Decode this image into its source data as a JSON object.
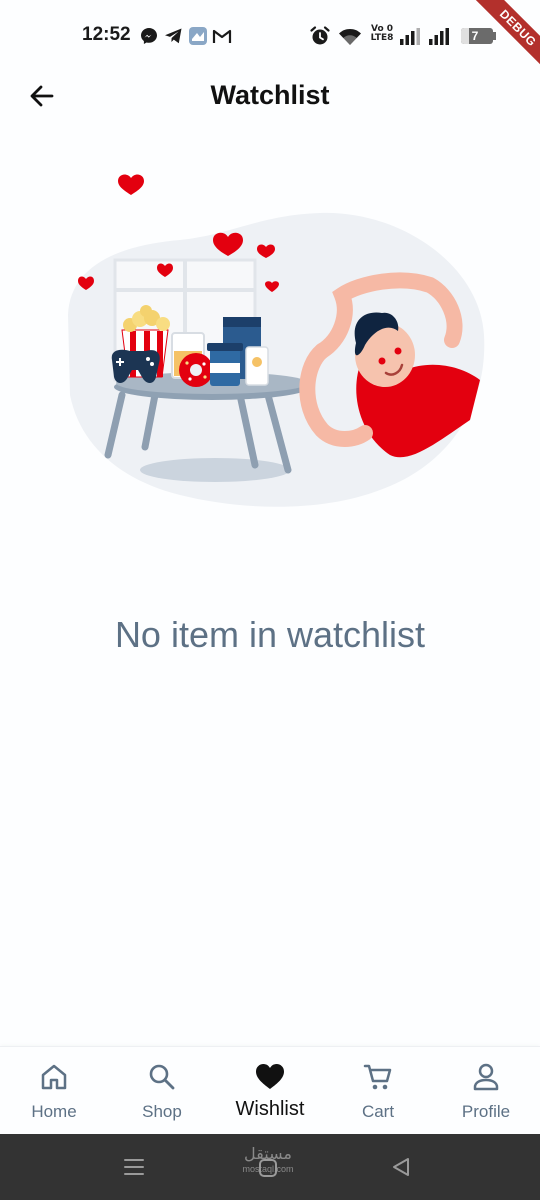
{
  "status_bar": {
    "time": "12:52",
    "volte_label": "Vo)\nLTE2",
    "battery_level": "7",
    "left_icons": [
      "messenger-icon",
      "telegram-icon",
      "app-icon",
      "gmail-icon"
    ],
    "right_icons": [
      "alarm-icon",
      "wifi-icon",
      "volte-icon",
      "signal-icon",
      "signal-icon",
      "battery-icon"
    ]
  },
  "debug_banner": "DEBUG",
  "header": {
    "title": "Watchlist",
    "back_icon": "arrow-left-icon"
  },
  "empty_state": {
    "illustration": "person-with-snacks-and-hearts-illustration",
    "message": "No item in watchlist"
  },
  "bottom_nav": {
    "active": "Wishlist",
    "items": [
      {
        "label": "Home",
        "icon": "home-icon"
      },
      {
        "label": "Shop",
        "icon": "search-icon"
      },
      {
        "label": "Wishlist",
        "icon": "heart-icon"
      },
      {
        "label": "Cart",
        "icon": "cart-icon"
      },
      {
        "label": "Profile",
        "icon": "person-icon"
      }
    ]
  },
  "system_nav": {
    "watermark": "مستقل",
    "watermark_sub": "mostaql.com",
    "buttons": [
      "recents-icon",
      "home-icon",
      "back-icon"
    ]
  },
  "colors": {
    "accent": "#e3000f",
    "muted": "#5d7185",
    "title": "#111111",
    "system_nav_bg": "#333333",
    "debug_ribbon": "#b3302c"
  }
}
